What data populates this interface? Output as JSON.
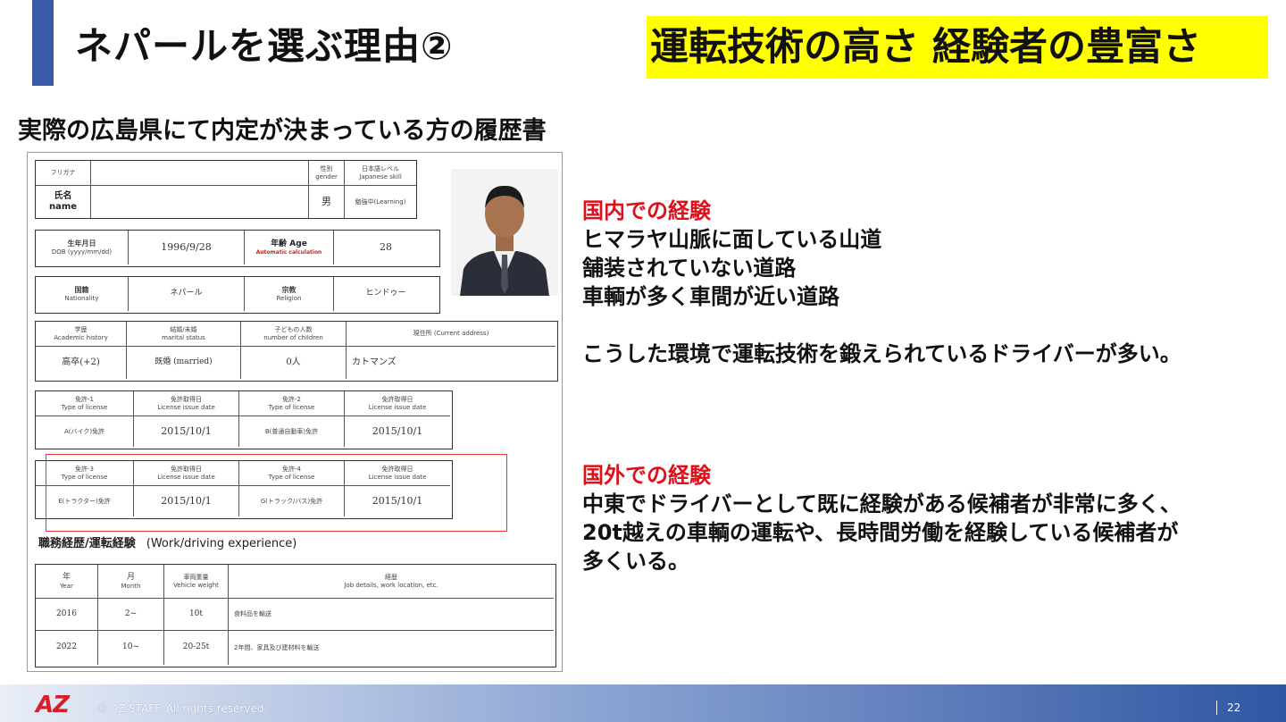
{
  "slide": {
    "title": "ネパールを選ぶ理由②",
    "highlight": "運転技術の高さ 経験者の豊富さ",
    "subtitle": "実際の広島県にて内定が決まっている方の履歴書",
    "page_number": "22",
    "copyright": "© AZ STAFF.  All rights reserved.",
    "logo_text": "AZ"
  },
  "colors": {
    "accent": "#3a5aa8",
    "highlight_bg": "#ffff00",
    "heading_red": "#e0101a",
    "footer_dark": "#2f56a3"
  },
  "resume": {
    "basic": {
      "furigana": "フリガナ",
      "name_label": "氏名",
      "name_label_en": "name",
      "gender_label": "性別",
      "gender_label_en": "gender",
      "gender_value": "男",
      "jp_level_label": "日本語レベル",
      "jp_level_label_en": "Japanese skill",
      "jp_level_value": "勉強中(Learning)"
    },
    "dob": {
      "label": "生年月日",
      "label_en": "DOB (yyyy/mm/dd)",
      "value": "1996/9/28",
      "age_label": "年齢 Age",
      "age_note": "Automatic calculation",
      "age_value": "28"
    },
    "nation": {
      "label": "国籍",
      "label_en": "Nationality",
      "value": "ネパール",
      "religion_label": "宗教",
      "religion_label_en": "Religion",
      "religion_value": "ヒンドゥー"
    },
    "education": {
      "headers": [
        "学歴",
        "結婚/未婚",
        "子どもの人数",
        "現住所 (Current address)"
      ],
      "headers_en": [
        "Academic history",
        "marital status",
        "number of children",
        ""
      ],
      "values": [
        "高卒(+2)",
        "既婚 (married)",
        "0人",
        "カトマンズ"
      ]
    },
    "licenses_a": {
      "headers": [
        "免許-1",
        "免許取得日",
        "免許-2",
        "免許取得日"
      ],
      "headers_en": [
        "Type of license",
        "License issue date",
        "Type of license",
        "License issue date"
      ],
      "values": [
        "A(バイク)免許",
        "2015/10/1",
        "B(普通自動車)免許",
        "2015/10/1"
      ]
    },
    "licenses_b": {
      "headers": [
        "免許-3",
        "免許取得日",
        "免許-4",
        "免許取得日"
      ],
      "headers_en": [
        "Type of license",
        "License issue date",
        "Type of license",
        "License issue date"
      ],
      "values": [
        "E(トラクター)免許",
        "2015/10/1",
        "G(トラック/バス)免許",
        "2015/10/1"
      ]
    },
    "work_title": "職務経歴/運転経験",
    "work_title_en": "(Work/driving experience)",
    "work": {
      "headers": [
        "年",
        "月",
        "車両重量",
        "経歴"
      ],
      "headers_en": [
        "Year",
        "Month",
        "Vehicle weight",
        "Job details, work location, etc."
      ],
      "rows": [
        [
          "2016",
          "2~",
          "10t",
          "食料品を輸送"
        ],
        [
          "2022",
          "10~",
          "20-25t",
          "2年間、家具及び建材料を輸送"
        ]
      ]
    }
  },
  "domestic": {
    "heading": "国内での経験",
    "lines": [
      "ヒマラヤ山脈に面している山道",
      "舗装されていない道路",
      "車輌が多く車間が近い道路",
      "",
      "こうした環境で運転技術を鍛えられているドライバーが多い。"
    ]
  },
  "overseas": {
    "heading": "国外での経験",
    "lines": [
      "中東でドライバーとして既に経験がある候補者が非常に多く、",
      "20t越えの車輌の運転や、長時間労働を経験している候補者が",
      "多くいる。"
    ]
  }
}
